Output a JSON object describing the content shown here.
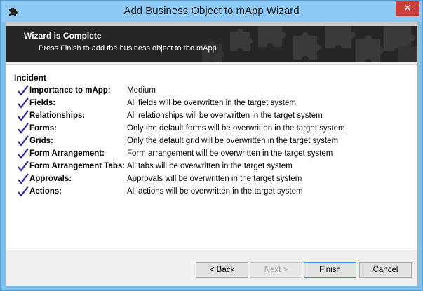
{
  "window": {
    "title": "Add Business Object to mApp Wizard",
    "close_label": "✕"
  },
  "banner": {
    "heading": "Wizard is Complete",
    "subtitle": "Press Finish to add the business object to the mApp"
  },
  "summary": {
    "section_title": "Incident",
    "rows": [
      {
        "label": "Importance to mApp:",
        "value": "Medium"
      },
      {
        "label": "Fields:",
        "value": "All fields will be overwritten in the target system"
      },
      {
        "label": "Relationships:",
        "value": "All relationships will be overwritten in the target system"
      },
      {
        "label": "Forms:",
        "value": "Only the default forms will be overwritten in the target system"
      },
      {
        "label": "Grids:",
        "value": "Only the default grid will be overwritten in the target system"
      },
      {
        "label": "Form Arrangement:",
        "value": "Form arrangement will be overwritten in the target system"
      },
      {
        "label": "Form Arrangement Tabs:",
        "value": "All tabs will be overwritten in the target system"
      },
      {
        "label": "Approvals:",
        "value": "Approvals will be overwritten in the target system"
      },
      {
        "label": "Actions:",
        "value": "All actions will be overwritten in the target system"
      }
    ]
  },
  "buttons": {
    "back": "< Back",
    "next": "Next >",
    "finish": "Finish",
    "cancel": "Cancel"
  },
  "colors": {
    "titlebar": "#8ec8f4",
    "banner": "#262626",
    "check": "#2a2a9a",
    "close": "#c7403a"
  }
}
